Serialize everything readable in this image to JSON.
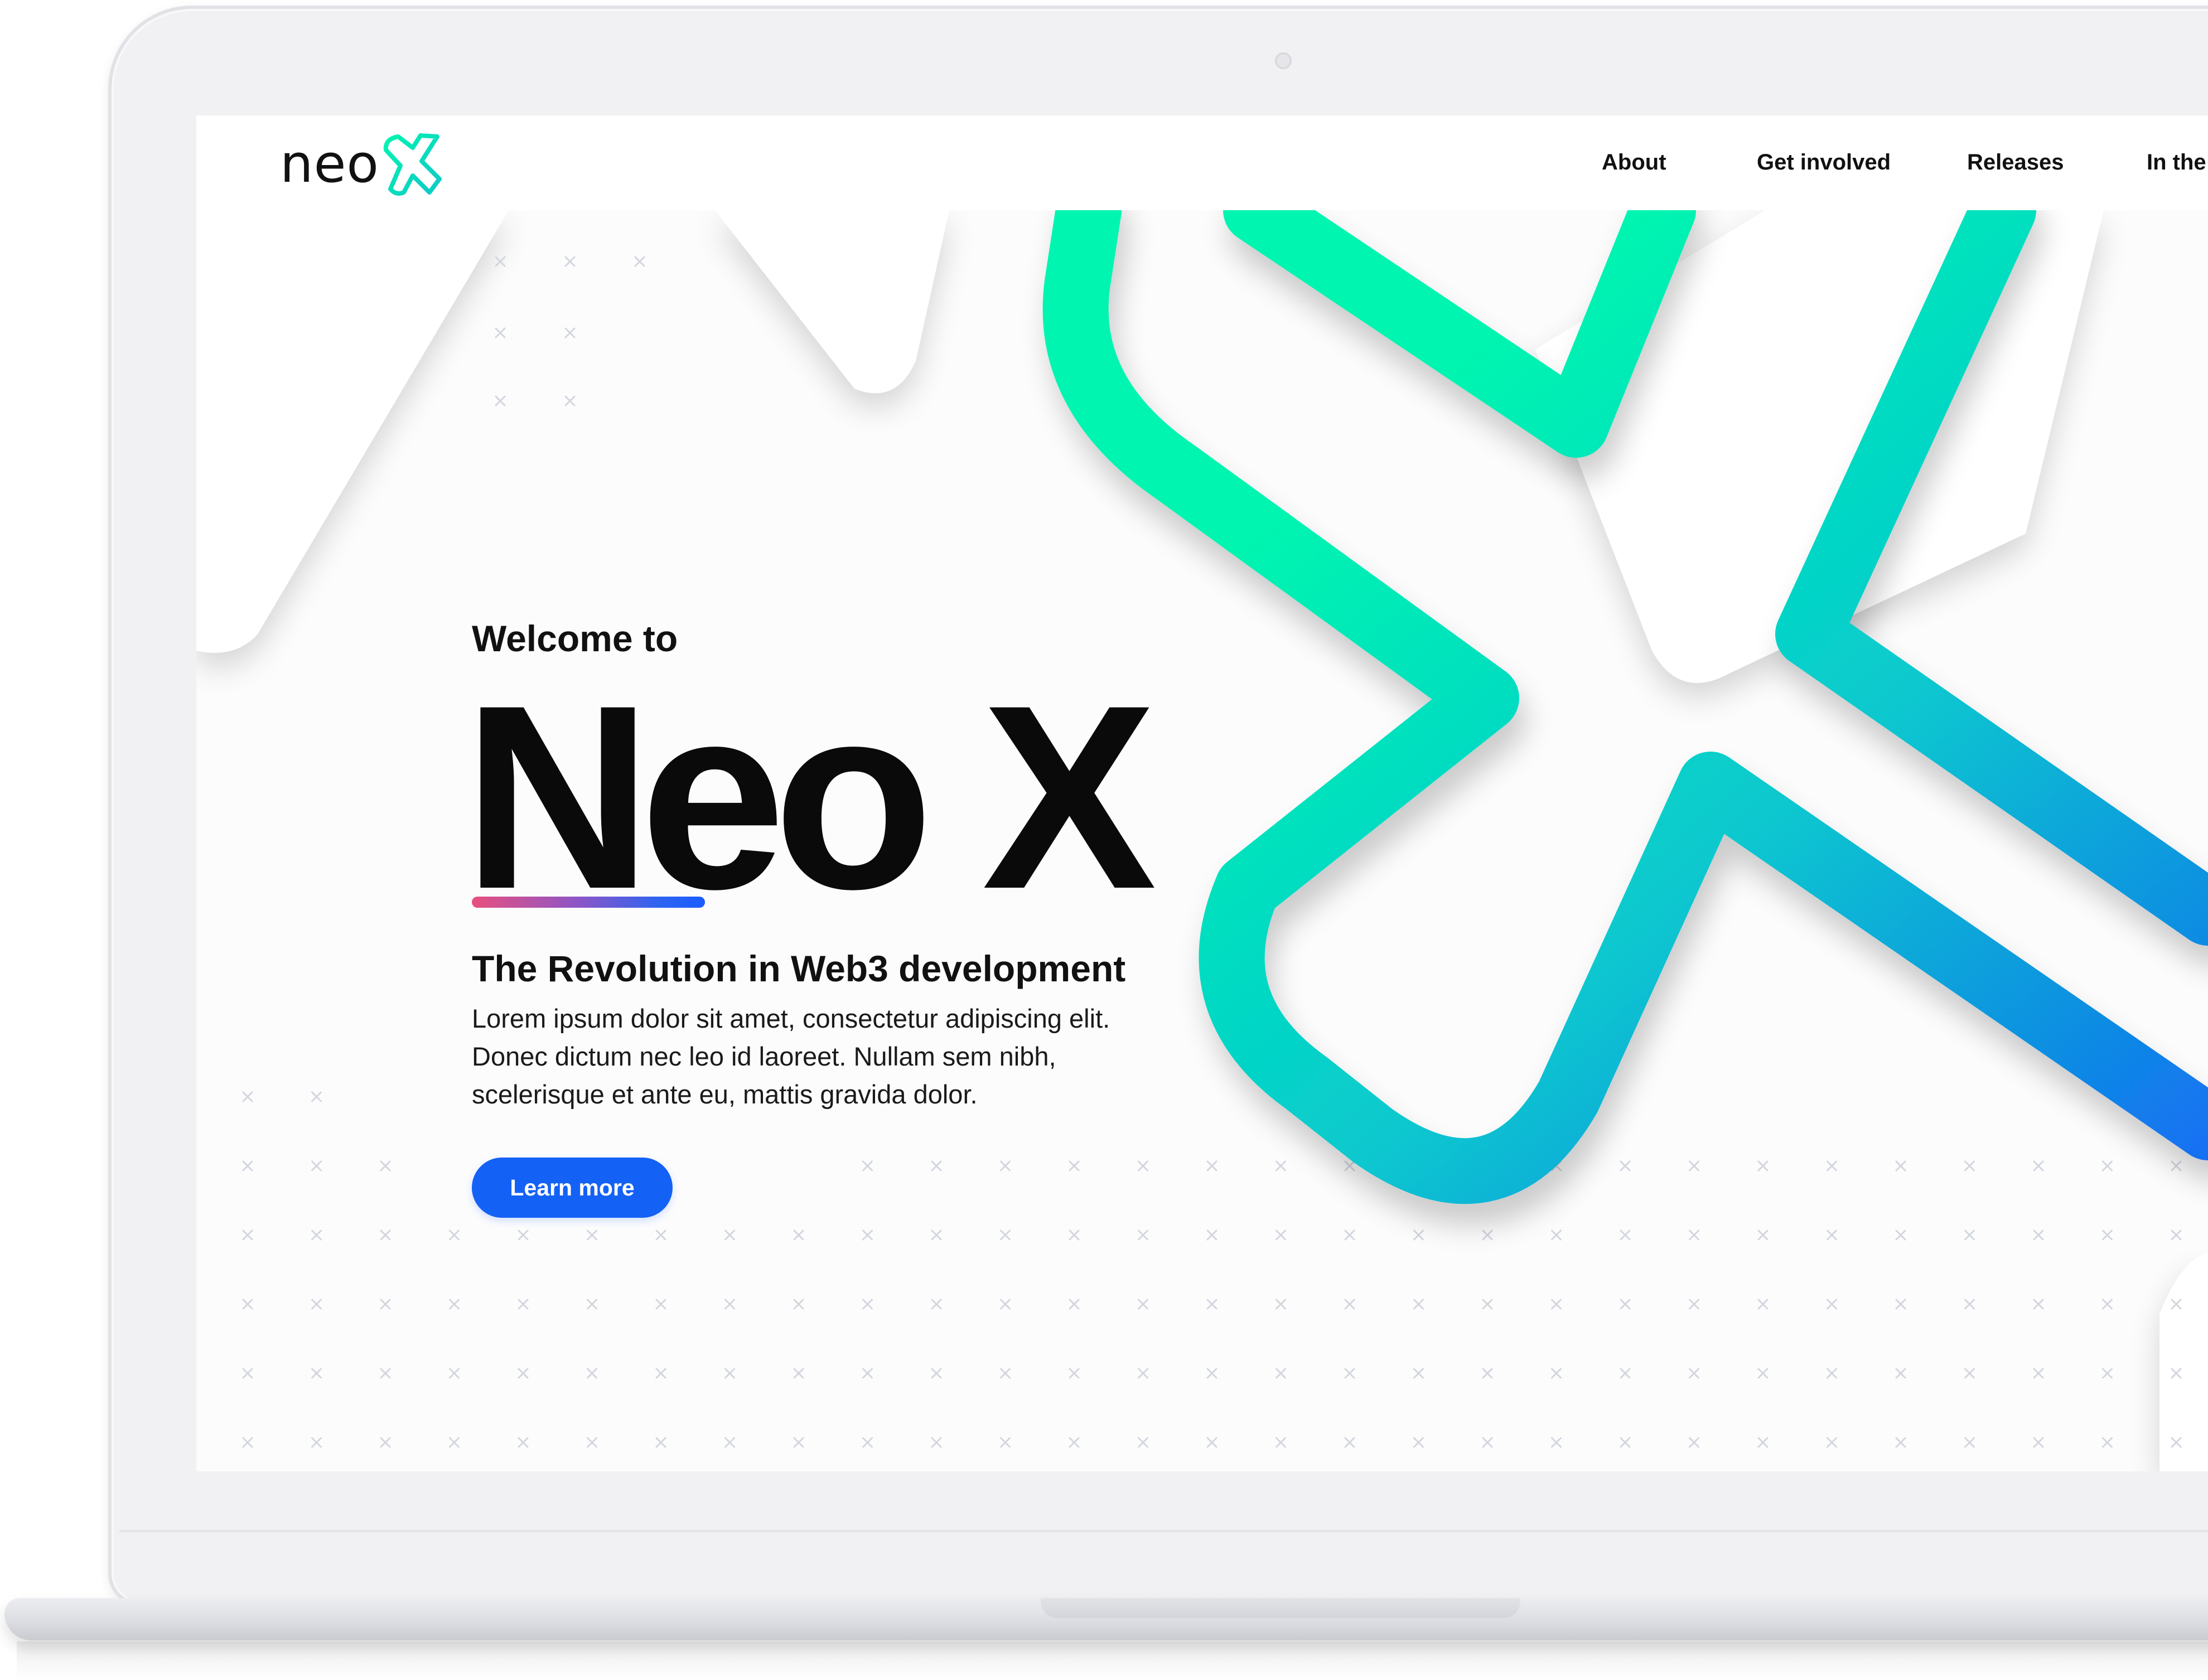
{
  "brand": {
    "logo_text": "neo",
    "logo_icon": "neo-x-logo-icon",
    "accent_green": "#00f5b0",
    "accent_blue": "#1a5cff"
  },
  "nav": {
    "items": [
      {
        "label": "About"
      },
      {
        "label": "Get involved"
      },
      {
        "label": "Releases"
      },
      {
        "label": "In the"
      }
    ]
  },
  "hero": {
    "welcome": "Welcome to",
    "title": "Neo X",
    "subtitle": "The Revolution in Web3 development",
    "body_lines": [
      "Lorem ipsum dolor sit amet, consectetur adipiscing elit.",
      "Donec dictum nec leo id laoreet. Nullam sem nibh,",
      "scelerisque et ante eu, mattis gravida dolor."
    ],
    "cta_label": "Learn more",
    "cta_color": "#1461f5",
    "underline_gradient": [
      "#e8507f",
      "#8e56c6",
      "#1a5cff"
    ]
  },
  "decor": {
    "big_x_gradient": [
      "#00f5b0",
      "#08b8d8",
      "#1a5cff"
    ],
    "background_pattern": "cross-dot-grid"
  }
}
